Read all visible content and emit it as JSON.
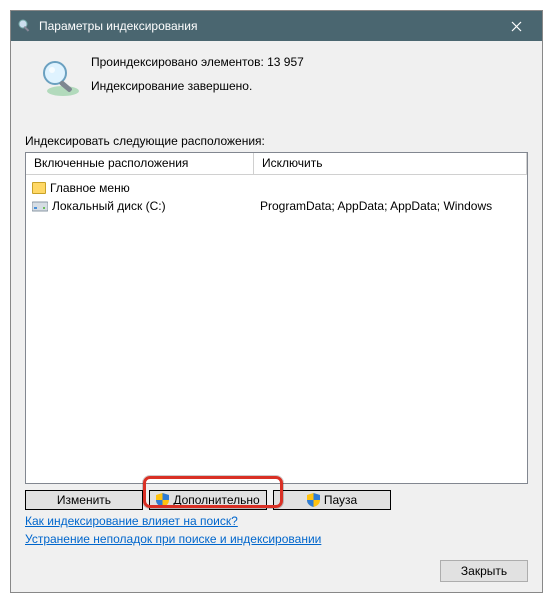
{
  "window": {
    "title": "Параметры индексирования"
  },
  "status": {
    "indexed_label": "Проиндексировано элементов: 13 957",
    "state": "Индексирование завершено."
  },
  "section_label": "Индексировать следующие расположения:",
  "columns": {
    "locations": "Включенные расположения",
    "exclude": "Исключить"
  },
  "locations": [
    {
      "icon": "folder",
      "name": "Главное меню",
      "exclude": ""
    },
    {
      "icon": "disk",
      "name": "Локальный диск (C:)",
      "exclude": "ProgramData; AppData; AppData; Windows"
    }
  ],
  "buttons": {
    "modify": "Изменить",
    "advanced": "Дополнительно",
    "pause": "Пауза"
  },
  "links": {
    "how_affects": "Как индексирование влияет на поиск?",
    "troubleshoot": "Устранение неполадок при поиске и индексировании"
  },
  "close": "Закрыть"
}
